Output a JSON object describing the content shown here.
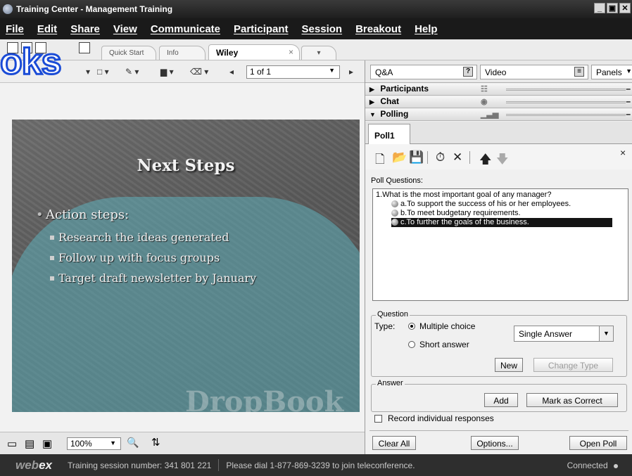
{
  "window": {
    "title": "Training Center - Management Training"
  },
  "menu": [
    "File",
    "Edit",
    "Share",
    "View",
    "Communicate",
    "Participant",
    "Session",
    "Breakout",
    "Help"
  ],
  "doc_tabs": [
    {
      "label": "Quick Start"
    },
    {
      "label": "Info"
    },
    {
      "label": "Wiley"
    }
  ],
  "watermark_brand": "oks",
  "toolbar": {
    "page": "1 of 1"
  },
  "slide": {
    "title": "Next Steps",
    "lead": "Action steps:",
    "bullets": [
      "Research the ideas generated",
      "Follow up with focus groups",
      "Target draft newsletter by January"
    ]
  },
  "slide_watermark": "DropBook",
  "bottom": {
    "zoom": "100%"
  },
  "status": {
    "logo_a": "web",
    "logo_b": "ex",
    "session": "Training session number: 341 801 221",
    "dial": "Please dial 1-877-869-3239 to join teleconference.",
    "connection": "Connected"
  },
  "panels": {
    "qa_label": "Q&A",
    "video_label": "Video",
    "panels_label": "Panels",
    "participants": "Participants",
    "chat": "Chat",
    "polling": "Polling"
  },
  "poll": {
    "tab": "Poll1",
    "questions_label": "Poll Questions:",
    "question": "1.What is the most important goal of any manager?",
    "answers": [
      "a.To support the success of his or her employees.",
      "b.To meet budgetary requirements.",
      "c.To further the goals of the business."
    ],
    "question_group": "Question",
    "type_label": "Type:",
    "multiple_choice": "Multiple choice",
    "short_answer": "Short answer",
    "answer_mode": "Single  Answer",
    "new_btn": "New",
    "change_type_btn": "Change Type",
    "answer_group": "Answer",
    "add_btn": "Add",
    "mark_correct_btn": "Mark as Correct",
    "record_label": "Record individual responses",
    "clear_all_btn": "Clear All",
    "options_btn": "Options...",
    "open_poll_btn": "Open Poll"
  }
}
